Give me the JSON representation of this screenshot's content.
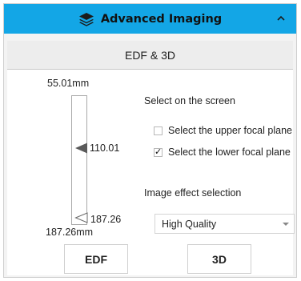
{
  "header": {
    "title": "Advanced Imaging",
    "icon": "layers-icon",
    "collapse_icon": "chevron-up-icon",
    "bg_color": "#13a6e6"
  },
  "section": {
    "title": "EDF & 3D"
  },
  "focal_slider": {
    "top_label": "55.01mm",
    "bottom_label": "187.26mm",
    "upper_marker_label": "110.01",
    "lower_marker_label": "187.26"
  },
  "selection": {
    "heading": "Select on the screen",
    "options": [
      {
        "label": "Select the upper focal plane",
        "checked": false,
        "mark": ""
      },
      {
        "label": "Select the lower focal plane",
        "checked": true,
        "mark": "✓"
      }
    ]
  },
  "image_effect": {
    "heading": "Image effect selection",
    "selected": "High Quality"
  },
  "buttons": {
    "edf": "EDF",
    "three_d": "3D"
  }
}
